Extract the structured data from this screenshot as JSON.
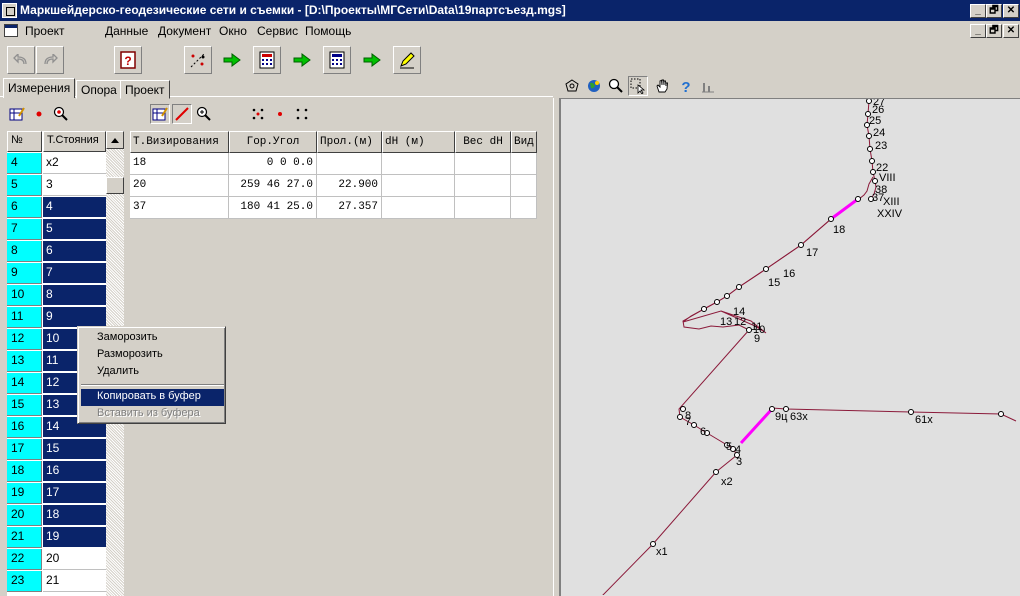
{
  "window": {
    "title": "Маркшейдерско-геодезические сети и съемки - [D:\\Проекты\\МГСети\\Data\\19партсъезд.mgs]",
    "min": "_",
    "restore": "🗗",
    "close": "✕"
  },
  "menu": {
    "items": [
      "Проект",
      "Данные",
      "Документ",
      "Окно",
      "Сервис",
      "Помощь"
    ]
  },
  "tabs": [
    "Измерения",
    "Опора",
    "Проект"
  ],
  "left_grid": {
    "headers": [
      "№",
      "Т.Стояния"
    ],
    "rows": [
      {
        "n": "4",
        "name": "x2",
        "selected": false
      },
      {
        "n": "5",
        "name": "3",
        "selected": false
      },
      {
        "n": "6",
        "name": "4",
        "selected": true
      },
      {
        "n": "7",
        "name": "5",
        "selected": true
      },
      {
        "n": "8",
        "name": "6",
        "selected": true
      },
      {
        "n": "9",
        "name": "7",
        "selected": true
      },
      {
        "n": "10",
        "name": "8",
        "selected": true
      },
      {
        "n": "11",
        "name": "9",
        "selected": true
      },
      {
        "n": "12",
        "name": "10",
        "selected": true
      },
      {
        "n": "13",
        "name": "11",
        "selected": true
      },
      {
        "n": "14",
        "name": "12",
        "selected": true
      },
      {
        "n": "15",
        "name": "13",
        "selected": true
      },
      {
        "n": "16",
        "name": "14",
        "selected": true
      },
      {
        "n": "17",
        "name": "15",
        "selected": true
      },
      {
        "n": "18",
        "name": "16",
        "selected": true
      },
      {
        "n": "19",
        "name": "17",
        "selected": true
      },
      {
        "n": "20",
        "name": "18",
        "selected": true
      },
      {
        "n": "21",
        "name": "19",
        "selected": true
      },
      {
        "n": "22",
        "name": "20",
        "selected": false
      },
      {
        "n": "23",
        "name": "21",
        "selected": false
      }
    ]
  },
  "right_table": {
    "headers": [
      "Т.Визирования",
      "Гор.Угол",
      "Прол.(м)",
      "dH (м)",
      "Вес dH",
      "Вид"
    ],
    "rows": [
      [
        "18",
        "0  0  0.0",
        "",
        "",
        "",
        ""
      ],
      [
        "20",
        "259 46 27.0",
        "22.900",
        "",
        "",
        ""
      ],
      [
        "37",
        "180 41 25.0",
        "27.357",
        "",
        "",
        ""
      ]
    ]
  },
  "context_menu": {
    "items": [
      "Заморозить",
      "Разморозить",
      "Удалить",
      "Копировать в буфер",
      "Вставить из буфера"
    ]
  },
  "map": {
    "labels": [
      "27",
      "26",
      "25",
      "24",
      "23",
      "22",
      "VIII",
      "38",
      "37",
      "XIII",
      "XXIV",
      "18",
      "17",
      "16",
      "15",
      "14",
      "13",
      "12",
      "11",
      "10",
      "9",
      "8",
      "7",
      "6",
      "5",
      "4",
      "3",
      "x2",
      "x1",
      "9ц",
      "63x",
      "61x"
    ],
    "line_color": "#8b1a3a",
    "highlight_color": "#ff00ff"
  }
}
